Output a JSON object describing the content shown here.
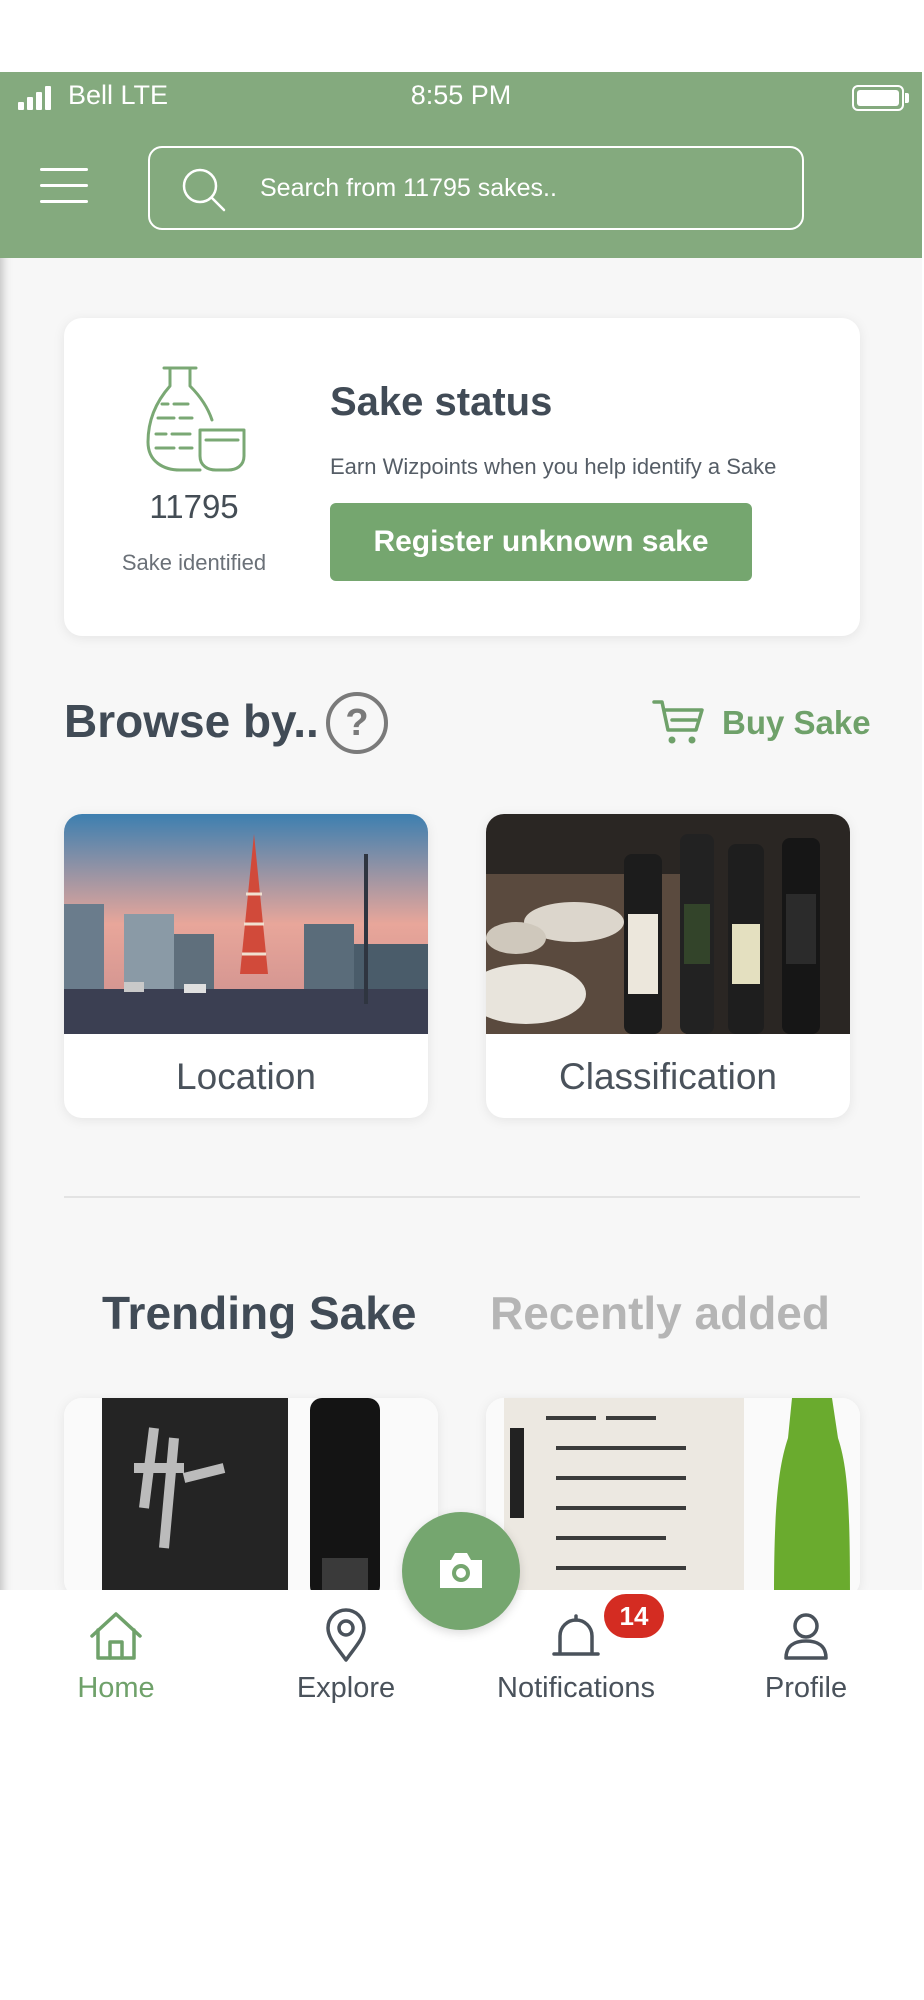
{
  "status_bar": {
    "carrier": "Bell LTE",
    "time": "8:55 PM"
  },
  "header": {
    "search_placeholder": "Search from 11795 sakes.."
  },
  "sake_status": {
    "count": "11795",
    "count_label": "Sake identified",
    "title": "Sake status",
    "subtitle": "Earn Wizpoints when you help identify a Sake",
    "register_button": "Register unknown sake"
  },
  "browse": {
    "title": "Browse by..",
    "help": "?",
    "buy_label": "Buy Sake",
    "cards": [
      {
        "label": "Location"
      },
      {
        "label": "Classification"
      }
    ]
  },
  "tabs": {
    "trending": "Trending Sake",
    "recent": "Recently added"
  },
  "nav": {
    "items": [
      {
        "label": "Home"
      },
      {
        "label": "Explore"
      },
      {
        "label": "Notifications"
      },
      {
        "label": "Profile"
      }
    ],
    "notification_badge": "14"
  },
  "colors": {
    "header_green": "#84aa7e",
    "accent_green": "#75a66f",
    "badge_red": "#d42c22",
    "text_dark": "#414b56"
  },
  "icons": [
    "signal-icon",
    "battery-icon",
    "menu-icon",
    "search-icon",
    "sake-bottle-icon",
    "help-icon",
    "cart-icon",
    "home-icon",
    "location-pin-icon",
    "bell-icon",
    "user-icon",
    "camera-icon"
  ]
}
